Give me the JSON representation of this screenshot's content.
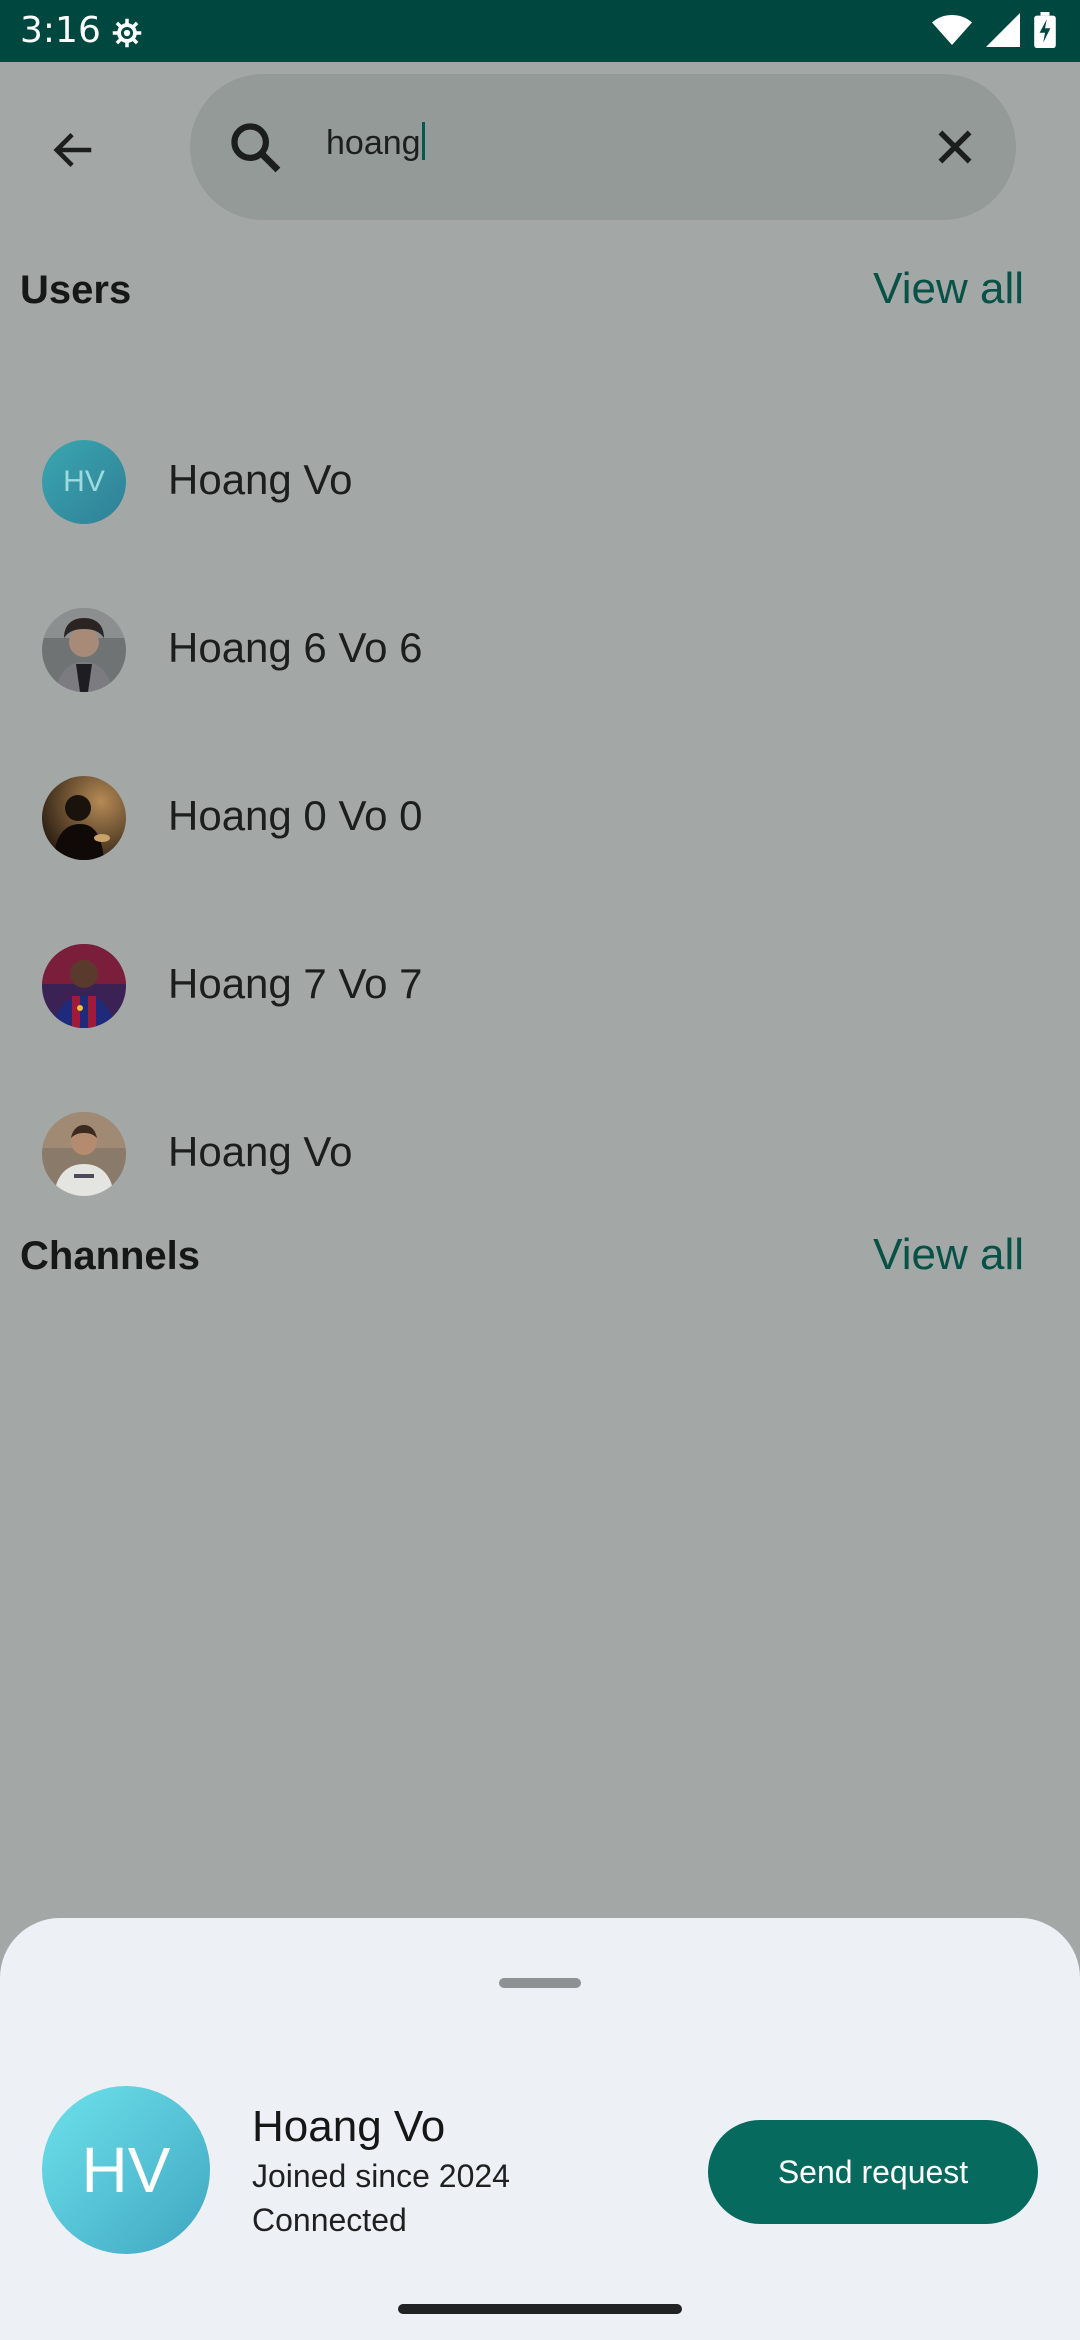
{
  "status_bar": {
    "time": "3:16",
    "icons": [
      "settings-gear-icon",
      "wifi-icon",
      "signal-icon",
      "battery-charging-icon"
    ]
  },
  "header": {
    "back_icon": "arrow-left-icon",
    "search": {
      "value": "hoang",
      "placeholder": "",
      "icon": "search-icon",
      "clear_icon": "close-icon"
    }
  },
  "users_section": {
    "title": "Users",
    "view_all": "View all",
    "items": [
      {
        "name": "Hoang Vo",
        "avatar": "initials",
        "initials": "HV"
      },
      {
        "name": "Hoang 6 Vo 6",
        "avatar": "photo"
      },
      {
        "name": "Hoang 0 Vo 0",
        "avatar": "photo"
      },
      {
        "name": "Hoang 7 Vo 7",
        "avatar": "photo"
      },
      {
        "name": "Hoang Vo",
        "avatar": "photo"
      }
    ]
  },
  "channels_section": {
    "title": "Channels",
    "view_all": "View all"
  },
  "bottom_sheet": {
    "initials": "HV",
    "name": "Hoang Vo",
    "joined": "Joined since 2024",
    "status": "Connected",
    "action_label": "Send request"
  },
  "colors": {
    "status_bar": "#004740",
    "accent": "#076a5f",
    "link": "#075147",
    "scrim": "#a3a8a6",
    "sheet": "#edf1f5"
  }
}
